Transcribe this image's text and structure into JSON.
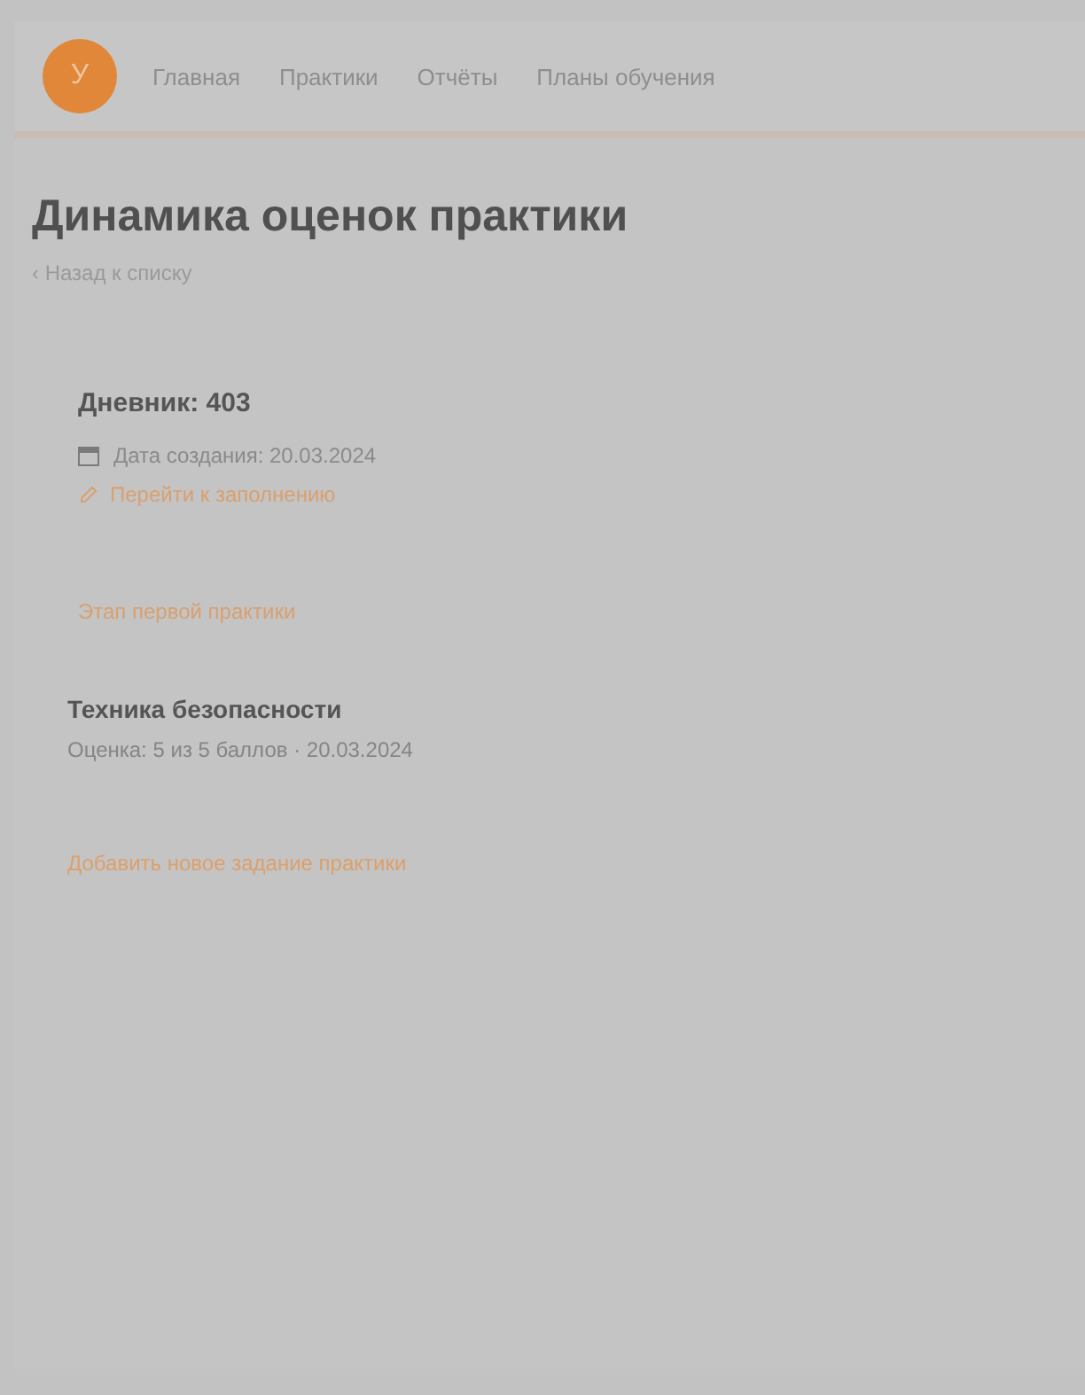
{
  "header": {
    "avatar": "У",
    "nav": [
      {
        "label": "Главная",
        "selected": false
      },
      {
        "label": "Практики",
        "selected": false
      },
      {
        "label": "Отчёты",
        "selected": false
      },
      {
        "label": "Планы обучения",
        "selected": false
      }
    ]
  },
  "page": {
    "title": "Динамика оценок практики",
    "back_link": "‹ Назад к списку"
  },
  "diary": {
    "title": "Дневник: 403",
    "date": "Дата создания: 20.03.2024",
    "edit_link": "Перейти к заполнению"
  },
  "stage_link": "Этап первой практики",
  "task": {
    "title": "Техника безопасности",
    "meta": "Оценка: 5 из 5 баллов · 20.03.2024"
  },
  "add_link": "Добавить новое задание практики"
}
